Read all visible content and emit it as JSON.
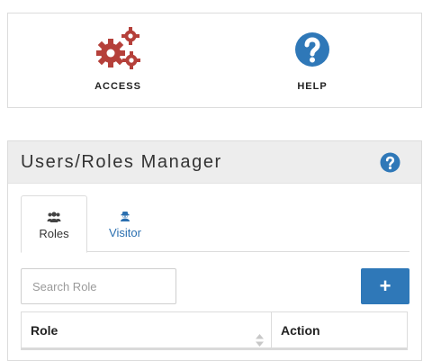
{
  "shortcuts": {
    "access": {
      "label": "ACCESS",
      "icon": "gears-icon",
      "color": "#b5403a"
    },
    "help": {
      "label": "HELP",
      "icon": "question-circle-icon",
      "color": "#2f78b8"
    }
  },
  "manager": {
    "title": "Users/Roles Manager",
    "help_icon": "question-circle-icon",
    "tabs": [
      {
        "label": "Roles",
        "icon": "users-icon",
        "active": true
      },
      {
        "label": "Visitor",
        "icon": "user-secret-icon",
        "active": false
      }
    ],
    "search": {
      "placeholder": "Search Role",
      "value": ""
    },
    "add_button": {
      "label": "+",
      "color": "#2f78b8"
    },
    "table": {
      "columns": [
        "Role",
        "Action"
      ]
    }
  }
}
